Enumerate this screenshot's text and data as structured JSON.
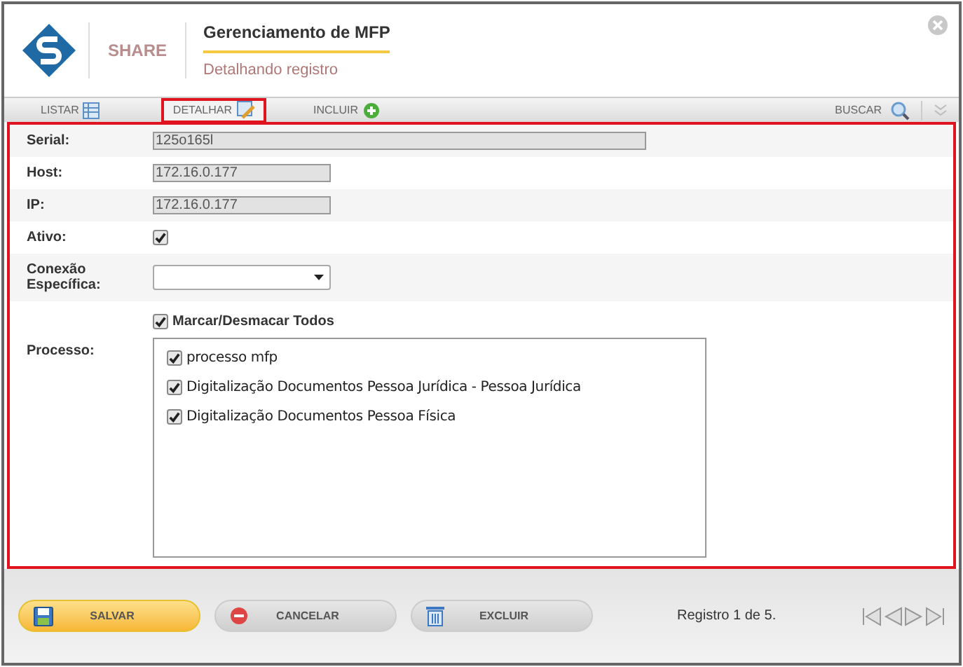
{
  "header": {
    "brand": "SHARE",
    "title": "Gerenciamento de MFP",
    "subtitle": "Detalhando registro"
  },
  "tabs": [
    {
      "label": "LISTAR",
      "kind": "list",
      "selected": false
    },
    {
      "label": "DETALHAR",
      "kind": "edit",
      "selected": true
    },
    {
      "label": "INCLUIR",
      "kind": "add",
      "selected": false
    }
  ],
  "search_label": "BUSCAR",
  "fields": [
    {
      "kind": "text",
      "label": "Serial:",
      "value": "125o165l",
      "wide": true
    },
    {
      "kind": "text",
      "label": "Host:",
      "value": "172.16.0.177",
      "wide": false
    },
    {
      "kind": "text",
      "label": "IP:",
      "value": "172.16.0.177",
      "wide": false
    },
    {
      "kind": "check",
      "label": "Ativo:",
      "checked": true
    },
    {
      "kind": "select",
      "label": "Conexão Específica:"
    }
  ],
  "select_all": {
    "label": "Marcar/Desmacar Todos",
    "checked": true
  },
  "processo": {
    "label": "Processo:",
    "items": [
      {
        "label": "processo mfp",
        "checked": true
      },
      {
        "label": "Digitalização Documentos Pessoa Jurídica - Pessoa Jurídica",
        "checked": true
      },
      {
        "label": "Digitalização Documentos Pessoa Física",
        "checked": true
      }
    ]
  },
  "buttons": [
    {
      "label": "SALVAR",
      "kind": "save"
    },
    {
      "label": "CANCELAR",
      "kind": "cancel"
    },
    {
      "label": "EXCLUIR",
      "kind": "delete"
    }
  ],
  "record_info": "Registro 1 de 5."
}
